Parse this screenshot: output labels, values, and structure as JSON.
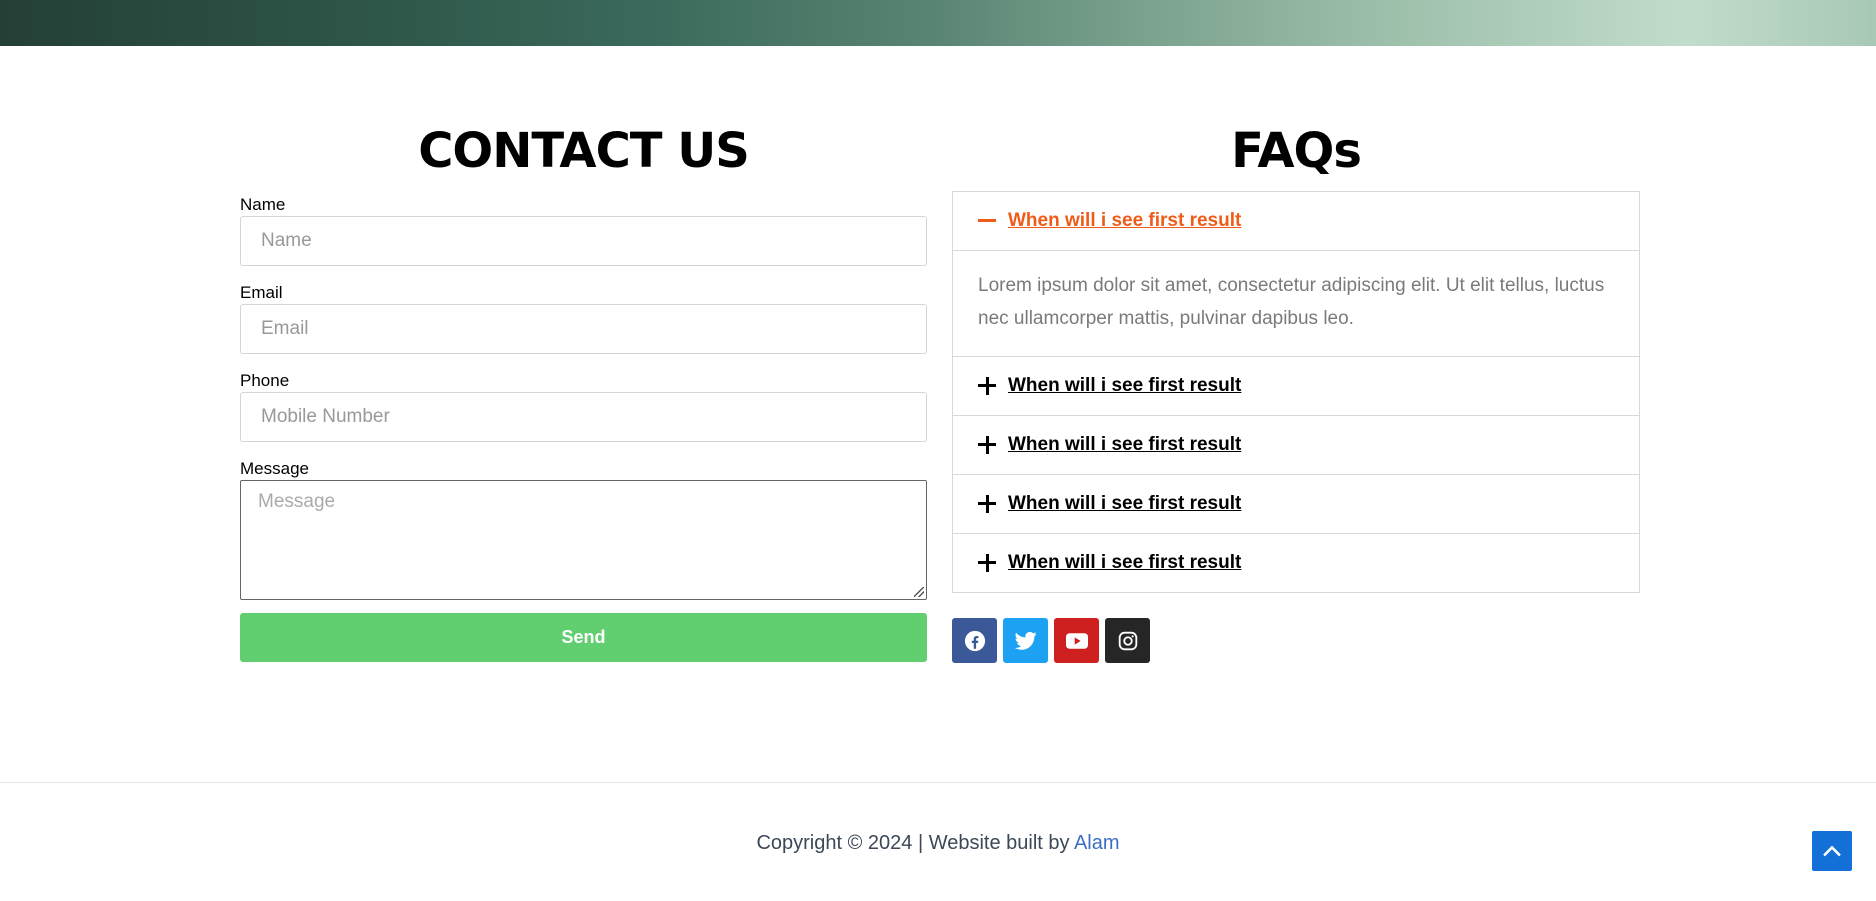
{
  "contact": {
    "title": "CONTACT US",
    "name_label": "Name",
    "name_placeholder": "Name",
    "email_label": "Email",
    "email_placeholder": "Email",
    "phone_label": "Phone",
    "phone_placeholder": "Mobile Number",
    "message_label": "Message",
    "message_placeholder": "Message",
    "send_label": "Send",
    "send_color": "#61ce70"
  },
  "faqs": {
    "title": "FAQs",
    "accent_color": "#ef5c1a",
    "items": [
      {
        "question": "When will i see first result",
        "answer": "Lorem ipsum dolor sit amet, consectetur adipiscing elit. Ut elit tellus, luctus nec ullamcorper mattis, pulvinar dapibus leo.",
        "open": true
      },
      {
        "question": "When will i see first result",
        "open": false
      },
      {
        "question": "When will i see first result",
        "open": false
      },
      {
        "question": "When will i see first result",
        "open": false
      },
      {
        "question": "When will i see first result",
        "open": false
      }
    ]
  },
  "social": [
    {
      "icon": "facebook-icon",
      "color": "#3b5998"
    },
    {
      "icon": "twitter-icon",
      "color": "#1da1f2"
    },
    {
      "icon": "youtube-icon",
      "color": "#cd201f"
    },
    {
      "icon": "instagram-icon",
      "color": "#262626"
    }
  ],
  "footer": {
    "copyright": "Copyright © 2024 | Website built by ",
    "author": "Alam"
  },
  "back_to_top": {
    "icon": "chevron-up-icon",
    "color": "#1270d6"
  }
}
